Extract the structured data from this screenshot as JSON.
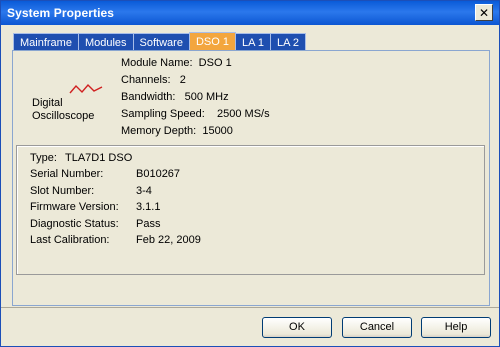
{
  "window": {
    "title": "System Properties",
    "close_label": "✕"
  },
  "tabs": [
    {
      "label": "Mainframe",
      "active": false
    },
    {
      "label": "Modules",
      "active": false
    },
    {
      "label": "Software",
      "active": false
    },
    {
      "label": "DSO 1",
      "active": true
    },
    {
      "label": "LA 1",
      "active": false
    },
    {
      "label": "LA 2",
      "active": false
    }
  ],
  "module": {
    "device_type_line1": "Digital",
    "device_type_line2": "Oscilloscope",
    "icon": "waveform-icon",
    "info": [
      {
        "label": "Module Name:",
        "value": "DSO 1"
      },
      {
        "label": "Channels:",
        "value": "2"
      },
      {
        "label": "Bandwidth:",
        "value": "500 MHz"
      },
      {
        "label": "Sampling Speed:",
        "value": "2500 MS/s"
      },
      {
        "label": "Memory Depth:",
        "value": "15000"
      }
    ]
  },
  "details": [
    {
      "label": "Type:",
      "value": "TLA7D1    DSO"
    },
    {
      "label": "Serial Number:",
      "value": "B010267"
    },
    {
      "label": "Slot Number:",
      "value": "3-4"
    },
    {
      "label": "Firmware Version:",
      "value": "3.1.1"
    },
    {
      "label": "Diagnostic Status:",
      "value": "Pass"
    },
    {
      "label": "Last Calibration:",
      "value": "Feb 22, 2009"
    }
  ],
  "buttons": {
    "ok": "OK",
    "cancel": "Cancel",
    "help": "Help"
  },
  "colors": {
    "titlebar": "#0a5bd8",
    "tab_inactive": "#1f4fb0",
    "tab_active": "#f3a63e",
    "waveform": "#d02020",
    "dialog_bg": "#ece9d8"
  }
}
